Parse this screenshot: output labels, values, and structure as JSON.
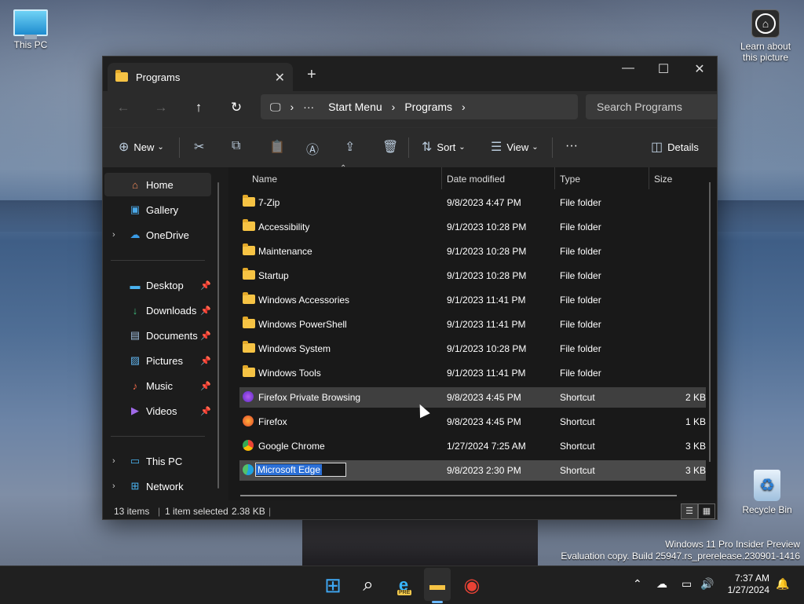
{
  "desktop": {
    "icons": {
      "this_pc": "This PC",
      "learn": "Learn about this picture",
      "recycle_bin": "Recycle Bin"
    },
    "watermark": {
      "line1": "Windows 11 Pro Insider Preview",
      "line2": "Evaluation copy. Build 25947.rs_prerelease.230901-1416"
    }
  },
  "window": {
    "tab_title": "Programs",
    "tab_close": "✕",
    "new_tab": "+",
    "controls": {
      "minimize": "—",
      "maximize": "☐",
      "close": "✕"
    },
    "nav": {
      "back": "←",
      "forward": "→",
      "up": "↑",
      "refresh": "↻"
    },
    "address": {
      "pc_glyph": "🖵",
      "sep": "›",
      "overflow": "···",
      "crumbs": [
        "Start Menu",
        "Programs"
      ]
    },
    "search_placeholder": "Search Programs",
    "commands": {
      "new": "New",
      "caret": "⌄",
      "sort": "Sort",
      "view": "View",
      "more": "···",
      "details": "Details",
      "icons": {
        "new": "⊕",
        "cut": "✂",
        "copy": "⧉",
        "paste": "📋",
        "rename": "Ⓐ",
        "share": "⇪",
        "delete": "🗑",
        "sort": "⇅",
        "view": "☰",
        "details": "◫"
      }
    },
    "sidebar": {
      "chevron": "›",
      "pin": "📌",
      "home": "Home",
      "gallery": "Gallery",
      "onedrive": "OneDrive",
      "desktop": "Desktop",
      "downloads": "Downloads",
      "documents": "Documents",
      "pictures": "Pictures",
      "music": "Music",
      "videos": "Videos",
      "this_pc": "This PC",
      "network": "Network",
      "icons": {
        "home": "⌂",
        "gallery": "▣",
        "onedrive": "☁",
        "desktop": "▬",
        "downloads": "↓",
        "documents": "▤",
        "pictures": "▨",
        "music": "♪",
        "videos": "▶",
        "this_pc": "▭",
        "network": "⊞"
      }
    },
    "columns": {
      "name": "Name",
      "date": "Date modified",
      "type": "Type",
      "size": "Size",
      "sort_caret": "⌃"
    },
    "rows": [
      {
        "name": "7-Zip",
        "date": "9/8/2023 4:47 PM",
        "type": "File folder",
        "size": ""
      },
      {
        "name": "Accessibility",
        "date": "9/1/2023 10:28 PM",
        "type": "File folder",
        "size": ""
      },
      {
        "name": "Maintenance",
        "date": "9/1/2023 10:28 PM",
        "type": "File folder",
        "size": ""
      },
      {
        "name": "Startup",
        "date": "9/1/2023 10:28 PM",
        "type": "File folder",
        "size": ""
      },
      {
        "name": "Windows Accessories",
        "date": "9/1/2023 11:41 PM",
        "type": "File folder",
        "size": ""
      },
      {
        "name": "Windows PowerShell",
        "date": "9/1/2023 11:41 PM",
        "type": "File folder",
        "size": ""
      },
      {
        "name": "Windows System",
        "date": "9/1/2023 10:28 PM",
        "type": "File folder",
        "size": ""
      },
      {
        "name": "Windows Tools",
        "date": "9/1/2023 11:41 PM",
        "type": "File folder",
        "size": ""
      },
      {
        "name": "Firefox Private Browsing",
        "date": "9/8/2023 4:45 PM",
        "type": "Shortcut",
        "size": "2 KB"
      },
      {
        "name": "Firefox",
        "date": "9/8/2023 4:45 PM",
        "type": "Shortcut",
        "size": "1 KB"
      },
      {
        "name": "Google Chrome",
        "date": "1/27/2024 7:25 AM",
        "type": "Shortcut",
        "size": "3 KB"
      },
      {
        "name": "Microsoft Edge",
        "date": "9/8/2023 2:30 PM",
        "type": "Shortcut",
        "size": "3 KB"
      }
    ],
    "status": {
      "count": "13 items",
      "selected": "1 item selected",
      "size": "2.38 KB",
      "divider": "|"
    },
    "view_buttons": {
      "details": "☰",
      "tiles": "▦"
    }
  },
  "taskbar": {
    "icons": {
      "start": "⊞",
      "search": "⌕",
      "edge": "e",
      "explorer": "▬",
      "chrome": "◉",
      "pre_badge": "PRE"
    },
    "tray": {
      "chevron": "⌃",
      "onedrive": "☁",
      "network": "▭",
      "volume": "🔊",
      "bell": "🔔"
    },
    "time": "7:37 AM",
    "date": "1/27/2024"
  },
  "colors": {
    "folder": "#f6c344",
    "selection": "#2b6fd6",
    "window_bg": "#1c1c1c"
  }
}
